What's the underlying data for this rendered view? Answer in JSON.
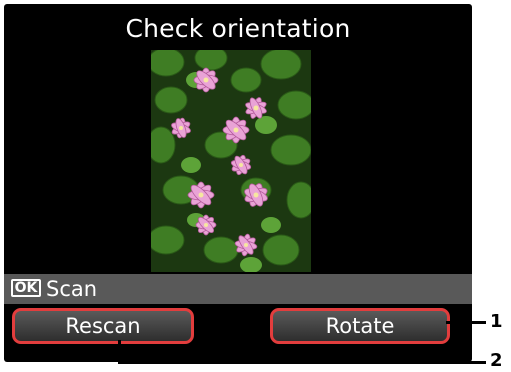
{
  "screen": {
    "title": "Check orientation",
    "ok_badge": "OK",
    "ok_action": "Scan"
  },
  "buttons": {
    "left_label": "Rescan",
    "right_label": "Rotate"
  },
  "callouts": {
    "one": "1",
    "two": "2"
  },
  "colors": {
    "screen_bg": "#000000",
    "highlight": "#e23d3d",
    "status_bar": "#595959"
  }
}
